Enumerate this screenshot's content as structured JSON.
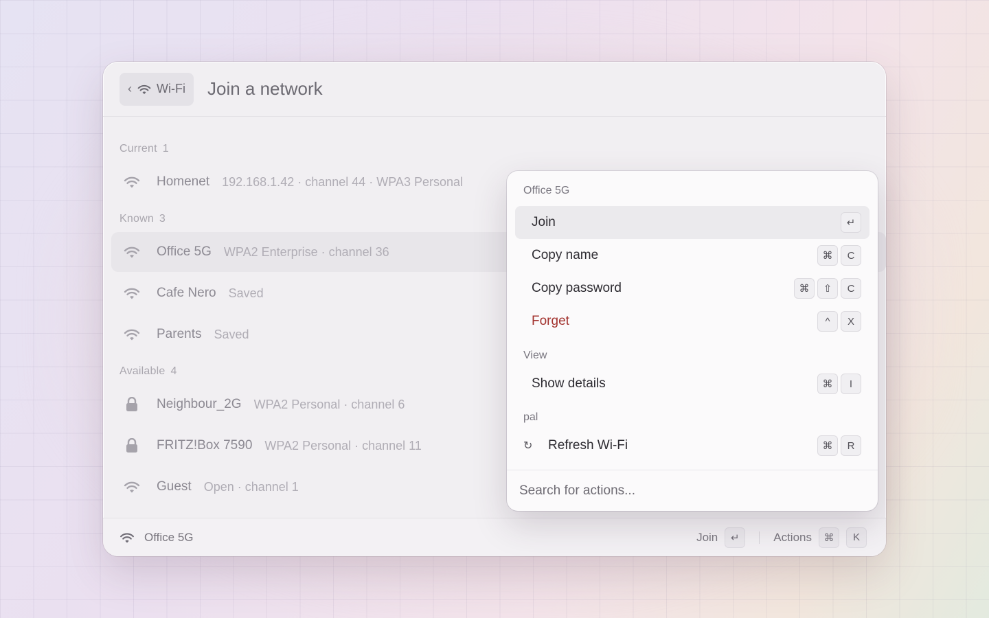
{
  "header": {
    "back_label": "Wi-Fi",
    "title": "Join a network"
  },
  "sections": {
    "current": {
      "label": "Current",
      "count": "1"
    },
    "known": {
      "label": "Known",
      "count": "3"
    },
    "available": {
      "label": "Available",
      "count": "4"
    }
  },
  "networks": {
    "current": [
      {
        "name": "Homenet",
        "meta": "192.168.1.42 · channel 44 · WPA3 Personal",
        "icon": "wifi-icon"
      }
    ],
    "known": [
      {
        "name": "Office 5G",
        "meta": "WPA2 Enterprise · channel 36",
        "icon": "wifi-icon"
      },
      {
        "name": "Cafe Nero",
        "meta": "Saved",
        "icon": "wifi-icon"
      },
      {
        "name": "Parents",
        "meta": "Saved",
        "icon": "wifi-icon"
      }
    ],
    "available": [
      {
        "name": "Neighbour_2G",
        "meta": "WPA2 Personal · channel 6",
        "icon": "lock-icon"
      },
      {
        "name": "FRITZ!Box 7590",
        "meta": "WPA2 Personal · channel 11",
        "icon": "lock-icon"
      },
      {
        "name": "Guest",
        "meta": "Open · channel 1",
        "icon": "wifi-icon"
      }
    ]
  },
  "popover": {
    "title": "Office 5G",
    "actions": [
      {
        "label": "Join",
        "keys": [
          "↵"
        ]
      },
      {
        "label": "Copy name",
        "keys": [
          "⌘",
          "C"
        ]
      },
      {
        "label": "Copy password",
        "keys": [
          "⌘",
          "⇧",
          "C"
        ]
      },
      {
        "label": "Forget",
        "keys": [
          "^",
          "X"
        ]
      }
    ],
    "view_section": "View",
    "view_actions": [
      {
        "label": "Show details",
        "keys": [
          "⌘",
          "I"
        ]
      }
    ],
    "pal_section": "pal",
    "pal_actions": [
      {
        "label": "Refresh Wi-Fi",
        "keys": [
          "⌘",
          "R"
        ],
        "icon": "↻"
      }
    ],
    "search_placeholder": "Search for actions..."
  },
  "footer": {
    "network": "Office 5G",
    "primary_label": "Join",
    "primary_key": "↵",
    "actions_label": "Actions",
    "actions_keys": [
      "⌘",
      "K"
    ]
  },
  "colors": {
    "danger": "#a2322e",
    "selected_row": "#e8e6ea"
  }
}
